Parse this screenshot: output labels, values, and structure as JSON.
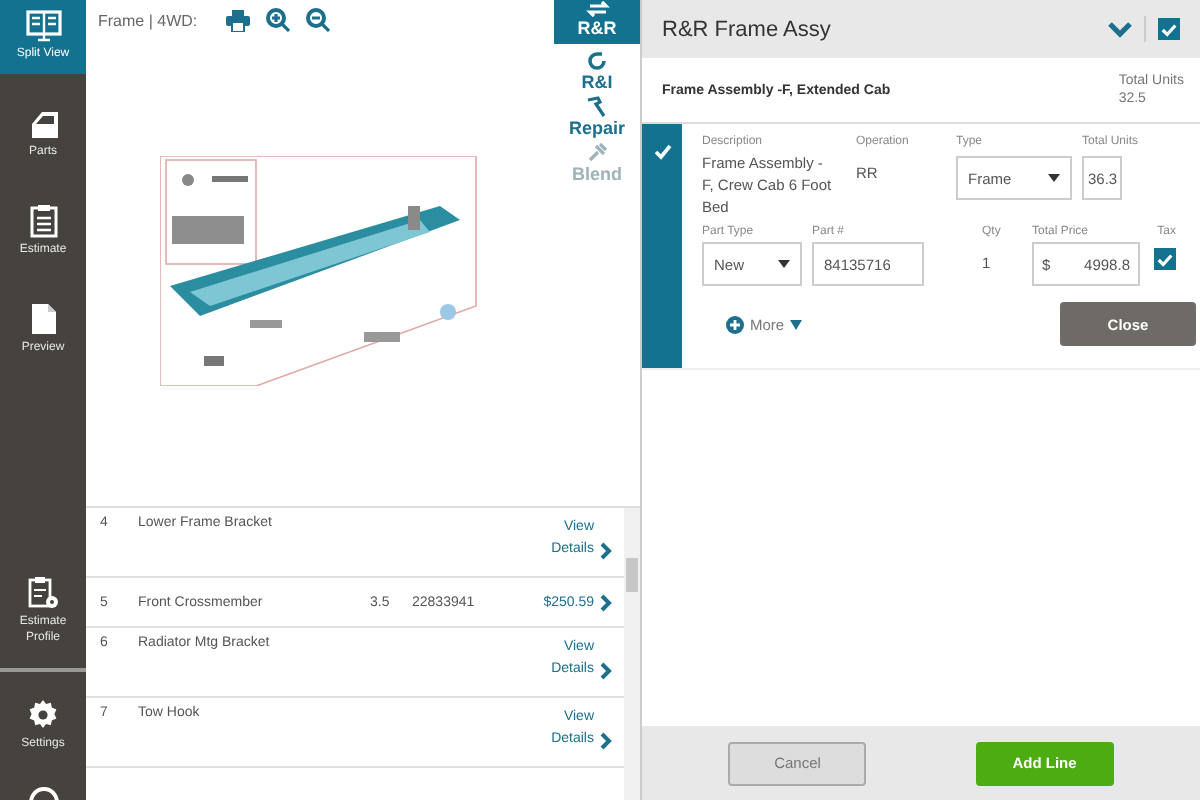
{
  "sidebar": {
    "items": [
      {
        "label": "Split View",
        "selected": true
      },
      {
        "label": "Parts",
        "selected": false
      },
      {
        "label": "Estimate",
        "selected": false
      },
      {
        "label": "Preview",
        "selected": false
      },
      {
        "label": "Estimate Profile",
        "selected": false
      },
      {
        "label": "Settings",
        "selected": false
      }
    ]
  },
  "toolbar": {
    "breadcrumb": "Frame | 4WD:"
  },
  "operations": [
    {
      "label": "R&R",
      "selected": true,
      "disabled": false
    },
    {
      "label": "R&I",
      "selected": false,
      "disabled": false
    },
    {
      "label": "Repair",
      "selected": false,
      "disabled": false
    },
    {
      "label": "Blend",
      "selected": false,
      "disabled": true
    }
  ],
  "diagram": {
    "kind": "picture"
  },
  "parts_table": {
    "rows": [
      {
        "number": "4",
        "name": "Lower Frame Bracket",
        "link_top": "View",
        "link_bottom": "Details"
      },
      {
        "number": "5",
        "name": "Front Crossmember",
        "units": "3.5",
        "part_number": "22833941",
        "price": "$250.59"
      },
      {
        "number": "6",
        "name": "Radiator Mtg Bracket",
        "link_top": "View",
        "link_bottom": "Details"
      },
      {
        "number": "7",
        "name": "Tow Hook",
        "link_top": "View",
        "link_bottom": "Details"
      }
    ]
  },
  "panel": {
    "title": "R&R Frame Assy",
    "checked": true,
    "summary": {
      "title": "Frame Assembly -F, Extended Cab",
      "total_units_label": "Total Units",
      "total_units": "32.5"
    },
    "line": {
      "selected": true,
      "description_label": "Description",
      "description": "Frame Assembly -F, Crew Cab 6 Foot Bed",
      "operation_label": "Operation",
      "operation": "RR",
      "type_label": "Type",
      "type": "Frame",
      "total_units_label": "Total Units",
      "total_units": "36.3",
      "part_type_label": "Part Type",
      "part_type": "New",
      "part_number_label": "Part #",
      "part_number": "84135716",
      "qty_label": "Qty",
      "qty": "1",
      "total_price_label": "Total Price",
      "currency": "$",
      "total_price": "4998.8",
      "tax_label": "Tax",
      "tax": true,
      "more": "More",
      "close": "Close"
    }
  },
  "footer": {
    "cancel": "Cancel",
    "add": "Add Line"
  }
}
